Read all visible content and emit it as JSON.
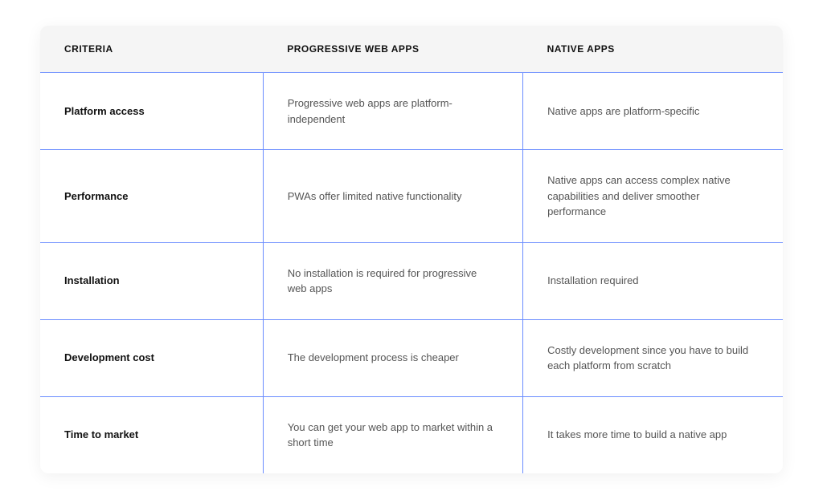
{
  "table": {
    "headers": [
      "CRITERIA",
      "PROGRESSIVE WEB APPS",
      "NATIVE APPS"
    ],
    "rows": [
      {
        "criteria": "Platform access",
        "pwa": "Progressive web apps are platform-independent",
        "native": "Native apps are platform-specific"
      },
      {
        "criteria": "Performance",
        "pwa": "PWAs offer limited native functionality",
        "native": "Native apps can access complex native capabilities and deliver smoother performance"
      },
      {
        "criteria": "Installation",
        "pwa": "No installation is required for progressive web apps",
        "native": "Installation required"
      },
      {
        "criteria": "Development cost",
        "pwa": "The development process is cheaper",
        "native": "Costly development since you have to build each platform from scratch"
      },
      {
        "criteria": "Time to market",
        "pwa": "You can get your web app to market within a short time",
        "native": "It takes more time to build a native app"
      }
    ]
  }
}
